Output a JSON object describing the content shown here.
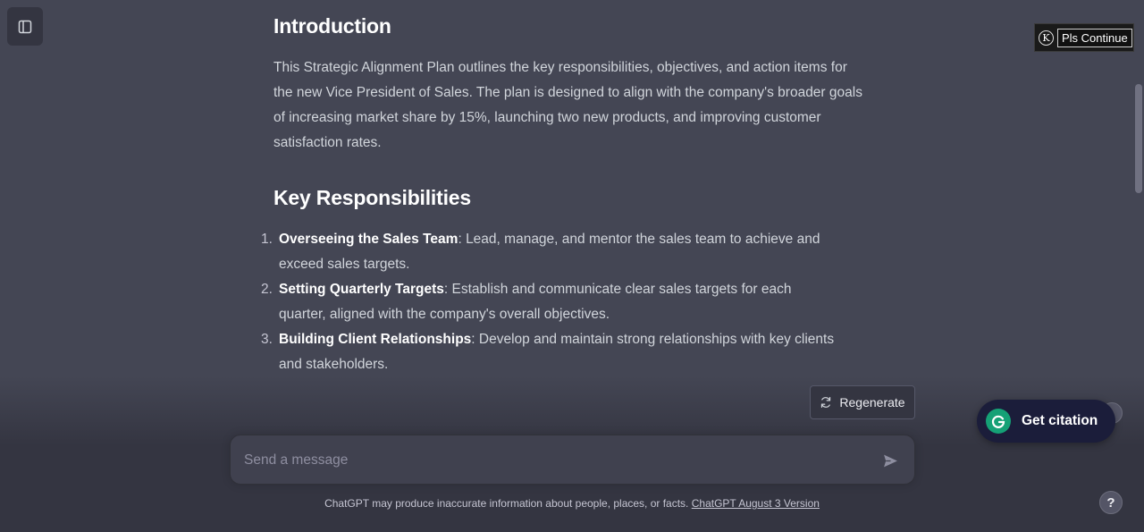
{
  "article": {
    "intro_heading": "Introduction",
    "intro_text": "This Strategic Alignment Plan outlines the key responsibilities, objectives, and action items for the new Vice President of Sales. The plan is designed to align with the company's broader goals of increasing market share by 15%, launching two new products, and improving customer satisfaction rates.",
    "resp_heading": "Key Responsibilities",
    "items": [
      {
        "num": "1.",
        "title": "Overseeing the Sales Team",
        "text": ": Lead, manage, and mentor the sales team to achieve and exceed sales targets."
      },
      {
        "num": "2.",
        "title": "Setting Quarterly Targets",
        "text": ": Establish and communicate clear sales targets for each quarter, aligned with the company's overall objectives."
      },
      {
        "num": "3.",
        "title": "Building Client Relationships",
        "text": ": Develop and maintain strong relationships with key clients and stakeholders."
      }
    ]
  },
  "extension": {
    "logo_letter": "K",
    "button_label": "Pls Continue"
  },
  "regenerate_label": "Regenerate",
  "composer": {
    "placeholder": "Send a message"
  },
  "footer": {
    "disclaimer": "ChatGPT may produce inaccurate information about people, places, or facts. ",
    "version_link": "ChatGPT August 3 Version"
  },
  "citation_label": "Get citation",
  "help_label": "?",
  "icons": {
    "sidebar": "sidebar-toggle-icon",
    "regenerate": "refresh-icon",
    "send": "send-icon",
    "grammarly": "grammarly-g-icon"
  },
  "colors": {
    "background": "#444654",
    "footer_background": "#343541",
    "input_background": "#40414f",
    "citation_background": "#1b1d3a",
    "grammarly_green": "#15a176"
  }
}
